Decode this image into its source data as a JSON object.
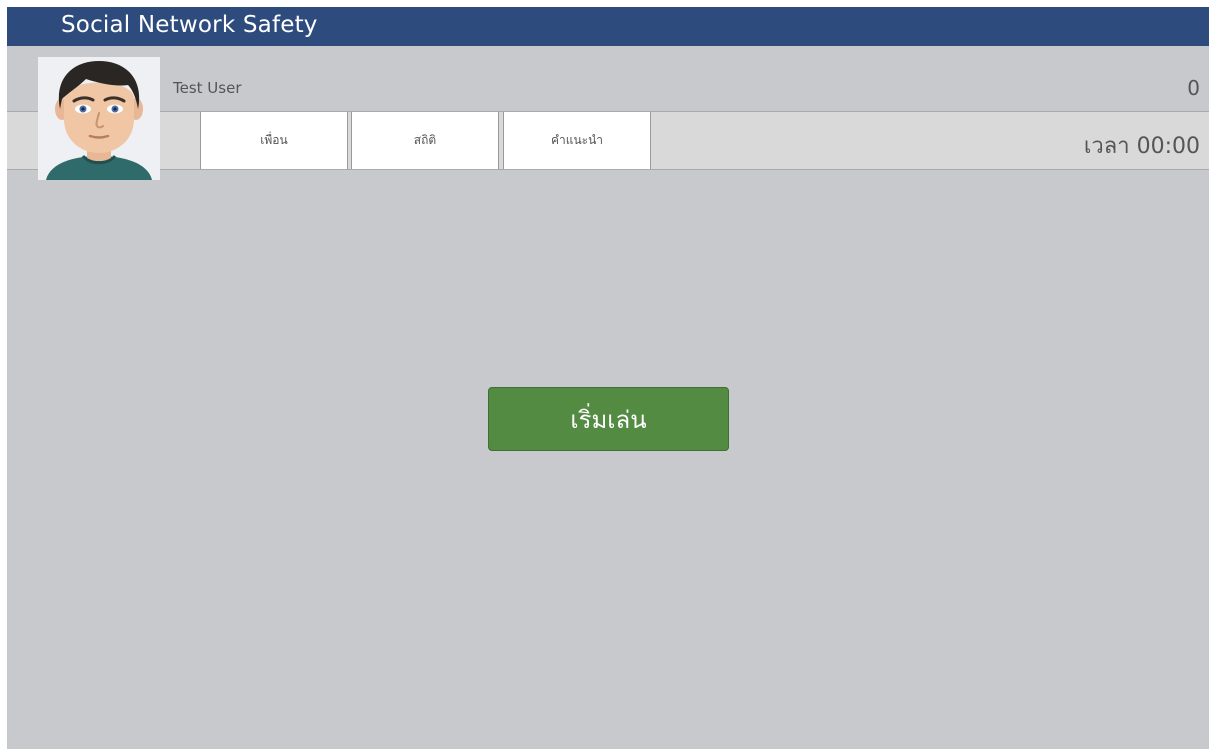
{
  "app": {
    "title": "Social Network Safety"
  },
  "user": {
    "name": "Test User",
    "score": "0",
    "avatar_icon": "avatar-icon"
  },
  "tabs": [
    {
      "label": "เพื่อน"
    },
    {
      "label": "สถิติ"
    },
    {
      "label": "คำแนะนำ"
    }
  ],
  "status": {
    "timer": "เวลา 00:00"
  },
  "main": {
    "start_label": "เริ่มเล่น"
  },
  "colors": {
    "titlebar": "#2e4b7e",
    "background": "#c8c9cd",
    "start_button": "#548b43"
  }
}
